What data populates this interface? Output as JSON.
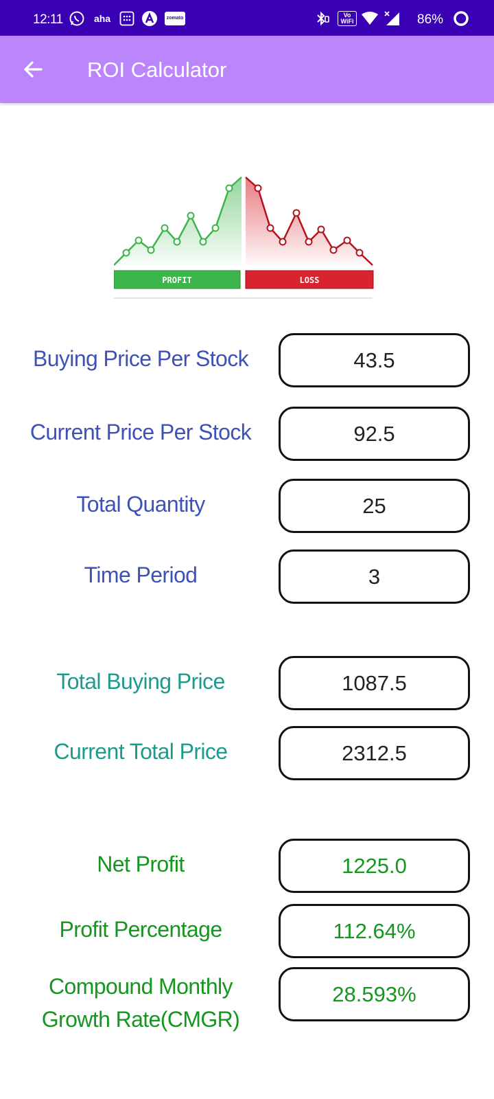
{
  "status_bar": {
    "time": "12:11",
    "notification_icons": [
      "whatsapp-icon",
      "aha-icon",
      "calculator-app-icon",
      "a-app-icon",
      "zomato-icon"
    ],
    "aha_text": "aha",
    "zomato_text": "zomato",
    "system_icons": [
      "bluetooth-icon",
      "vowifi-icon",
      "wifi-icon",
      "signal-icon",
      "battery-icon"
    ],
    "vowifi_text_top": "Vo",
    "vowifi_text_bottom": "WiFi",
    "battery": "86%"
  },
  "app_bar": {
    "title": "ROI Calculator",
    "back_icon": "arrow-back-icon",
    "color": "#bb86fc"
  },
  "illustration": {
    "profit_label": "PROFIT",
    "loss_label": "LOSS",
    "profit_color": "#3cb54a",
    "loss_color": "#d9232f"
  },
  "inputs": [
    {
      "label": "Buying Price Per Stock",
      "value": "43.5"
    },
    {
      "label": "Current Price Per Stock",
      "value": "92.5"
    },
    {
      "label": "Total Quantity",
      "value": "25"
    },
    {
      "label": "Time Period",
      "value": "3"
    }
  ],
  "totals": [
    {
      "label": "Total Buying Price",
      "value": "1087.5"
    },
    {
      "label": "Current Total Price",
      "value": "2312.5"
    }
  ],
  "results": [
    {
      "label": "Net Profit",
      "value": "1225.0"
    },
    {
      "label": "Profit Percentage",
      "value": "112.64%"
    },
    {
      "label_line1": "Compound Monthly",
      "label_line2": "Growth Rate(CMGR)",
      "value": "28.593%"
    }
  ],
  "colors": {
    "status_bar": "#3a00b4",
    "input_label": "#3f51b5",
    "total_label": "#1e9a8c",
    "result_text": "#15961f"
  }
}
